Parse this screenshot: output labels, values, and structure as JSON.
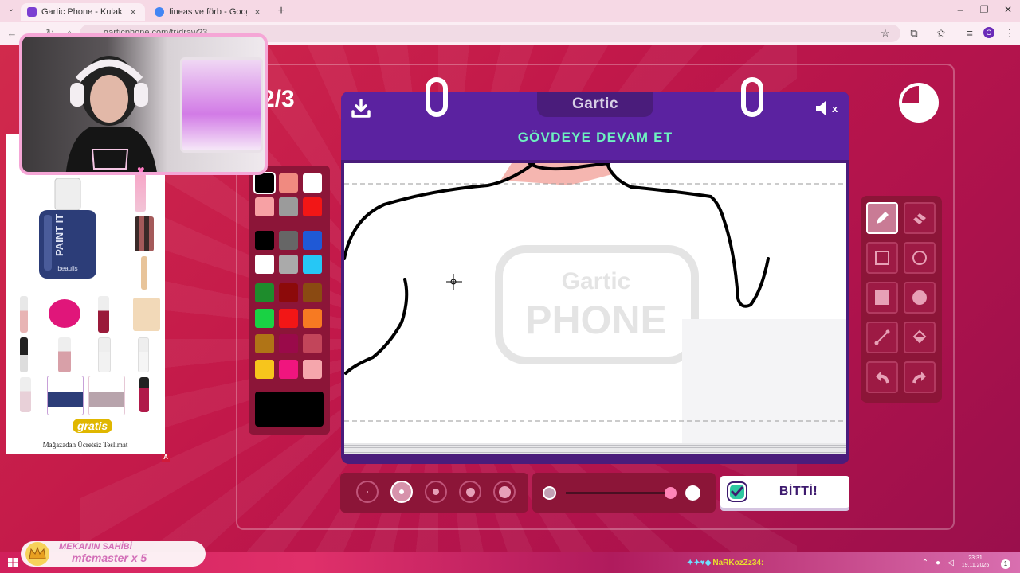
{
  "browser": {
    "tabs": [
      {
        "label": "Gartic Phone - Kulaktan Kulağa",
        "close": "×",
        "favicon_color": "#7b3fd2"
      },
      {
        "label": "fineas ve förb - Google'da Ara",
        "close": "×",
        "favicon_color": "#4285f4"
      }
    ],
    "new_tab": "+",
    "tab_list": "⌄",
    "window_controls": {
      "minimize": "–",
      "restore": "❐",
      "close": "✕"
    },
    "url": "garticphone.com/tr/draw?3",
    "profile_initial": "O"
  },
  "game": {
    "round": "2/3",
    "logo": "Gartic",
    "prompt": "GÖVDEYE DEVAM ET",
    "done_label": "BİTTİ!",
    "watermark_top": "Gartic",
    "watermark_bottom": "PHONE",
    "mute_label": "x",
    "palette": [
      "#000000",
      "#f08a80",
      "#ffffff",
      "#f7a1a4",
      "#9b9b9b",
      "#f21616",
      "#000000",
      "#666666",
      "#1f59d6",
      "#ffffff",
      "#aaaaaa",
      "#26c7f5",
      "#1e8c2c",
      "#8c0a0a",
      "#8a4a12",
      "#19d244",
      "#f21616",
      "#f77a22",
      "#b07416",
      "#9a0a4a",
      "#c2455a",
      "#f7c51c",
      "#f0157e",
      "#f5a6ac"
    ],
    "selected_color": "#000000",
    "brush_sizes_selected": 2,
    "opacity_percent": 100
  },
  "tools": [
    {
      "name": "pencil-tool",
      "active": true
    },
    {
      "name": "eraser-tool",
      "active": false
    },
    {
      "name": "rectangle-outline-tool",
      "active": false
    },
    {
      "name": "ellipse-outline-tool",
      "active": false
    },
    {
      "name": "rectangle-fill-tool",
      "active": false
    },
    {
      "name": "ellipse-fill-tool",
      "active": false
    },
    {
      "name": "line-tool",
      "active": false
    },
    {
      "name": "bucket-fill-tool",
      "active": false
    },
    {
      "name": "undo-tool",
      "active": false
    },
    {
      "name": "redo-tool",
      "active": false
    }
  ],
  "ad": {
    "product": "PAINT IT",
    "brand": "beaulis",
    "store": "gratis",
    "text": "Mağazadan Ücretsiz Teslimat",
    "badge": "A"
  },
  "stream": {
    "owner_title": "MEKANIN SAHİBİ",
    "owner_name": "mfcmaster x 5",
    "chat_user": "NaRKozZz34:"
  },
  "taskbar": {
    "time": "23:31",
    "date": "19.11.2025",
    "notifications": "1"
  }
}
